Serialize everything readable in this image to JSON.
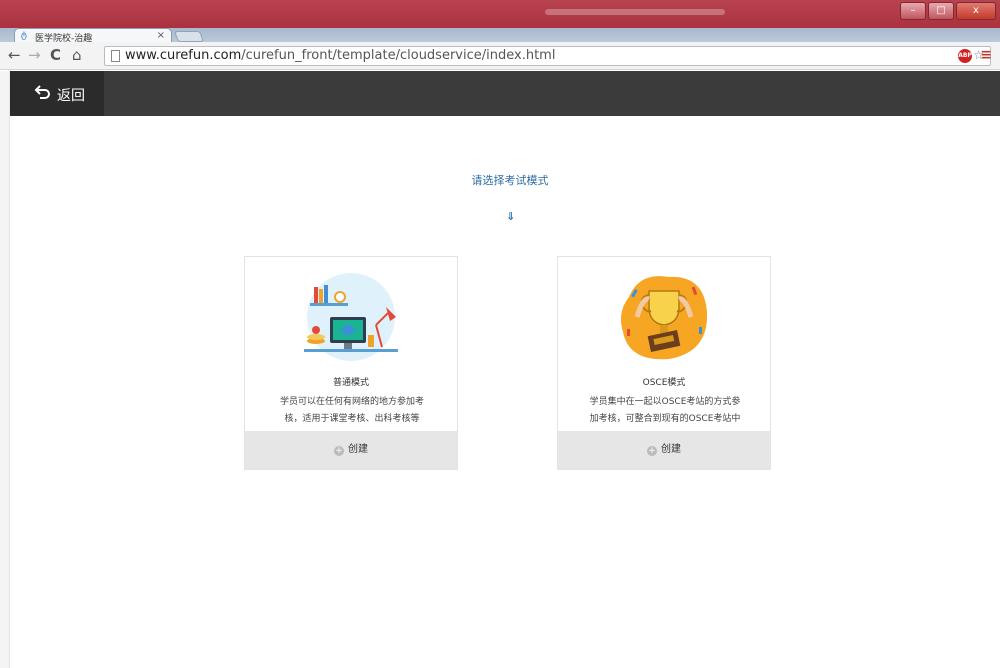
{
  "browser": {
    "tab_title": "医学院校-治趣",
    "tab_close": "×",
    "url_host": "www.curefun.com",
    "url_path": "/curefun_front/template/cloudservice/index.html",
    "window_minimize": "–",
    "window_restore": "□",
    "window_close": "x",
    "abp_label": "ABP",
    "menu_glyph": "≡",
    "zoom_glyph": "⚲",
    "star_glyph": "☆",
    "nav_back_glyph": "←",
    "nav_forward_glyph": "→",
    "reload_glyph": "C",
    "home_glyph": "⌂"
  },
  "header": {
    "back_label": "返回",
    "back_icon": "undo-arrow-icon"
  },
  "main": {
    "prompt": "请选择考试模式",
    "arrow": "⇓",
    "cards": [
      {
        "title": "普通模式",
        "desc": "学员可以在任何有网络的地方参加考核，适用于课堂考核、出科考核等",
        "create_label": "创建"
      },
      {
        "title": "OSCE模式",
        "desc": "学员集中在一起以OSCE考站的方式参加考核，可整合到现有的OSCE考站中",
        "create_label": "创建"
      }
    ]
  },
  "colors": {
    "header_bg": "#3b3b3b",
    "back_bg": "#2b2b2b",
    "accent_text": "#2e6da4",
    "create_bg": "#e6e6e6"
  }
}
